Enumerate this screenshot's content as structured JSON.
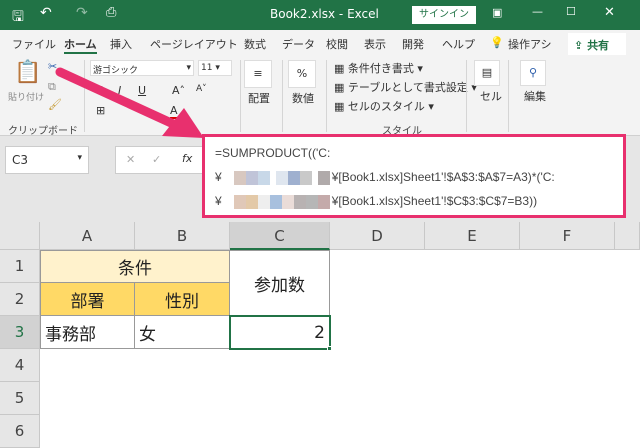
{
  "titlebar": {
    "title": "Book2.xlsx  -  Excel",
    "signin": "サインイン"
  },
  "tabs": [
    "ファイル",
    "ホーム",
    "挿入",
    "ページレイアウト",
    "数式",
    "データ",
    "校閲",
    "表示",
    "開発",
    "ヘルプ",
    "操作アシ"
  ],
  "share": "共有",
  "ribbon": {
    "paste": "貼り付け",
    "font_name": "游ゴシック",
    "font_size": "11",
    "clipboard": "クリップボード",
    "align": "配置",
    "number": "数値",
    "cond_format": "条件付き書式",
    "table_format": "テーブルとして書式設定",
    "cell_style": "セルのスタイル",
    "style": "スタイル",
    "cells": "セル",
    "edit": "編集"
  },
  "formula_bar": {
    "name_box": "C3",
    "line1": "=SUMPRODUCT(('C:",
    "line2_prefix": "¥",
    "line2": "¥[Book1.xlsx]Sheet1'!$A$3:$A$7=A3)*('C:",
    "line3_prefix": "¥",
    "line3": "¥[Book1.xlsx]Sheet1'!$C$3:$C$7=B3))"
  },
  "columns": [
    "A",
    "B",
    "C",
    "D",
    "E",
    "F"
  ],
  "rows": [
    "1",
    "2",
    "3",
    "4",
    "5",
    "6"
  ],
  "cells": {
    "A1": "条件",
    "A2": "部署",
    "B2": "性別",
    "C1": "参加数",
    "A3": "事務部",
    "B3": "女",
    "C3": "2"
  },
  "colors": {
    "title": "#217346",
    "highlight": "#e8306e",
    "header_light": "#fff2cc",
    "header_dark": "#ffd966"
  }
}
